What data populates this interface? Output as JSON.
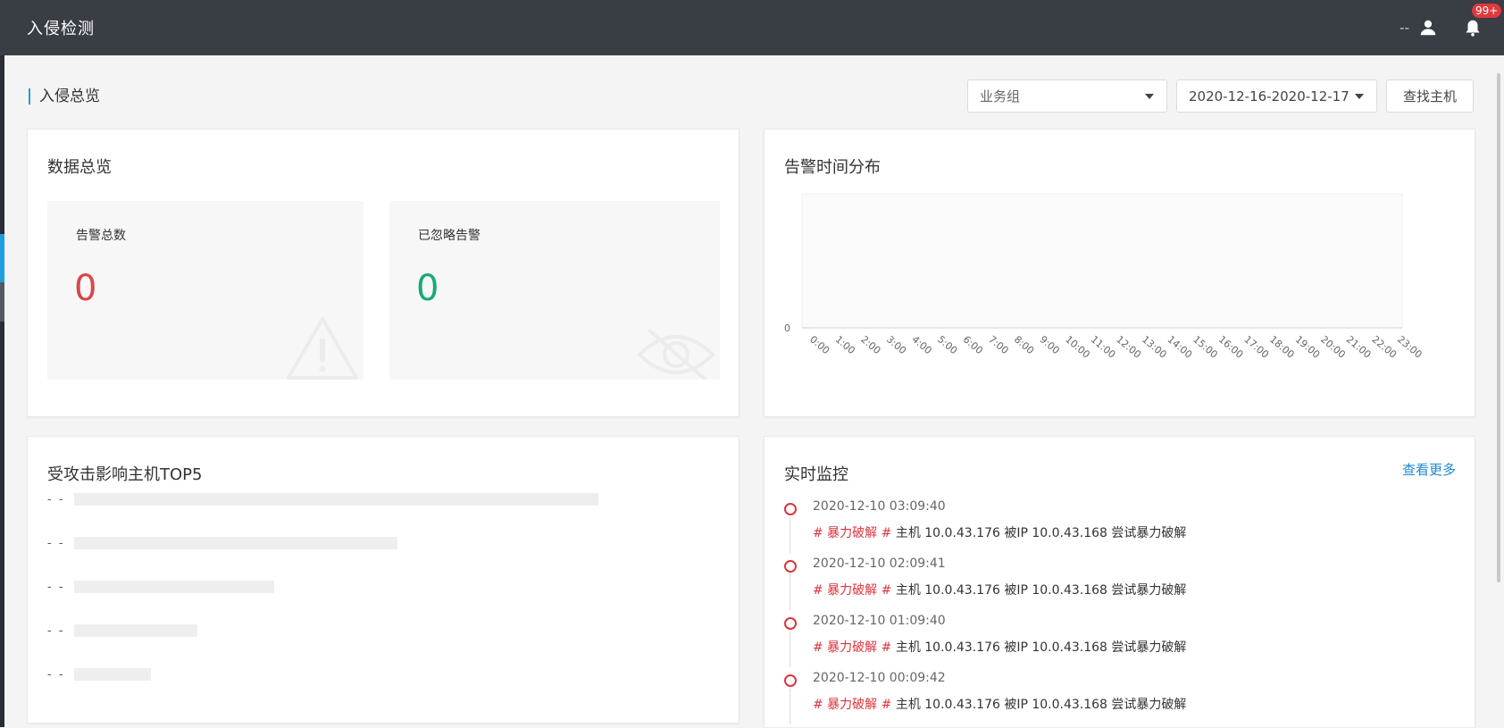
{
  "app": {
    "title": "入侵检测"
  },
  "header": {
    "username": "--",
    "notification_badge": "99+"
  },
  "section": {
    "title": "入侵总览"
  },
  "filters": {
    "group_select": "业务组",
    "date_range": "2020-12-16-2020-12-17",
    "find_host_button": "查找主机"
  },
  "overview": {
    "title": "数据总览",
    "total_alerts": {
      "label": "告警总数",
      "value": "0",
      "color": "#d9474b"
    },
    "ignored_alerts": {
      "label": "已忽略告警",
      "value": "0",
      "color": "#19a974"
    }
  },
  "time_distribution": {
    "title": "告警时间分布"
  },
  "chart_data": {
    "type": "line",
    "title": "告警时间分布",
    "x": [
      "0:00",
      "1:00",
      "2:00",
      "3:00",
      "4:00",
      "5:00",
      "6:00",
      "7:00",
      "8:00",
      "9:00",
      "10:00",
      "11:00",
      "12:00",
      "13:00",
      "14:00",
      "15:00",
      "16:00",
      "17:00",
      "18:00",
      "19:00",
      "20:00",
      "21:00",
      "22:00",
      "23:00"
    ],
    "series": [
      {
        "values": [
          0,
          0,
          0,
          0,
          0,
          0,
          0,
          0,
          0,
          0,
          0,
          0,
          0,
          0,
          0,
          0,
          0,
          0,
          0,
          0,
          0,
          0,
          0,
          0
        ]
      }
    ],
    "y_ticks": [
      "0"
    ],
    "grid": false
  },
  "top5": {
    "title": "受攻击影响主机TOP5",
    "items": [
      {
        "label": "- -",
        "ratio": 0.85
      },
      {
        "label": "- -",
        "ratio": 0.525
      },
      {
        "label": "- -",
        "ratio": 0.325
      },
      {
        "label": "- -",
        "ratio": 0.2
      },
      {
        "label": "- -",
        "ratio": 0.125
      }
    ]
  },
  "realtime": {
    "title": "实时监控",
    "more_link": "查看更多",
    "events": [
      {
        "time": "2020-12-10 03:09:40",
        "tag": "# 暴力破解 #",
        "message": " 主机 10.0.43.176 被IP 10.0.43.168 尝试暴力破解"
      },
      {
        "time": "2020-12-10 02:09:41",
        "tag": "# 暴力破解 #",
        "message": " 主机 10.0.43.176 被IP 10.0.43.168 尝试暴力破解"
      },
      {
        "time": "2020-12-10 01:09:40",
        "tag": "# 暴力破解 #",
        "message": " 主机 10.0.43.176 被IP 10.0.43.168 尝试暴力破解"
      },
      {
        "time": "2020-12-10 00:09:42",
        "tag": "# 暴力破解 #",
        "message": " 主机 10.0.43.176 被IP 10.0.43.168 尝试暴力破解"
      }
    ]
  }
}
